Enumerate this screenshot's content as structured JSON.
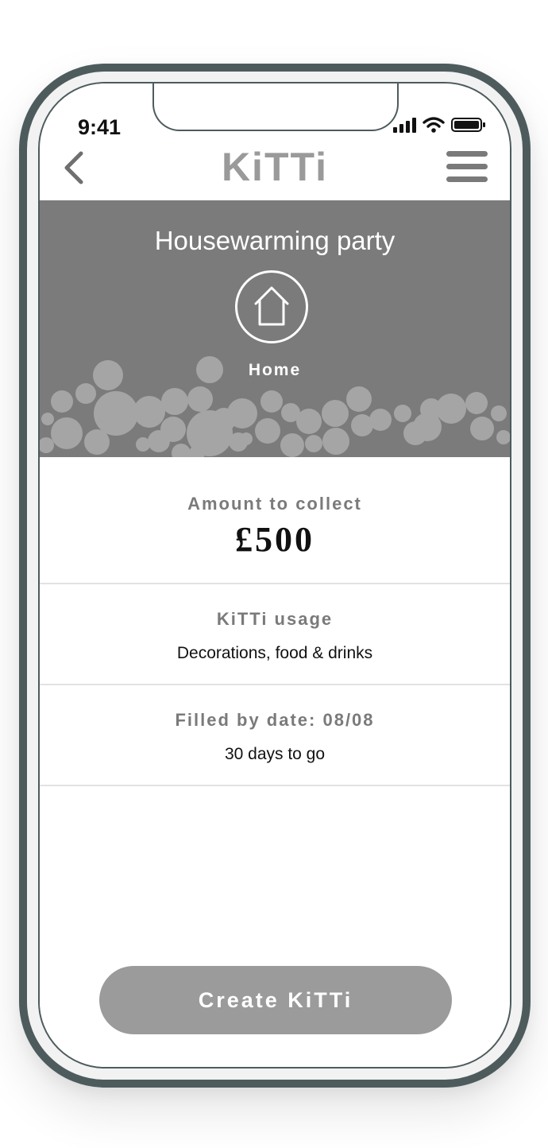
{
  "status_bar": {
    "time": "9:41"
  },
  "header": {
    "logo": "KiTTi",
    "back_icon": "chevron-left-icon",
    "menu_icon": "hamburger-menu-icon"
  },
  "hero": {
    "title": "Housewarming party",
    "category_label": "Home",
    "category_icon": "house-icon",
    "background": "#7b7b7b",
    "bubble_color": "#a5a5a5"
  },
  "details": {
    "amount_label": "Amount to collect",
    "amount_value": "£500",
    "usage_label": "KiTTi usage",
    "usage_value": "Decorations, food & drinks",
    "date_label": "Filled by date: 08/08",
    "date_value": "30 days to go"
  },
  "actions": {
    "create_label": "Create KiTTi",
    "create_color": "#9b9b9b"
  }
}
